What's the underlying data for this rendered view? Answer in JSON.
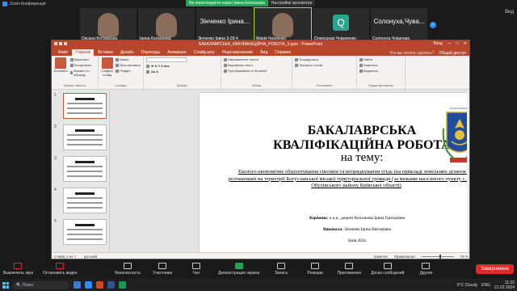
{
  "zoom": {
    "window_title": "Zoom Конференція",
    "banner_viewing": "Ви переглядаєте екран Ірина Колханова",
    "banner_options": "Настройки просмотра",
    "view_label": "Вид",
    "participants": [
      {
        "name": "Оксана Кустовська",
        "type": "video"
      },
      {
        "name": "Ірина Колханова",
        "type": "video"
      },
      {
        "name": "Зінченко Ірина 3-28-4",
        "type": "text",
        "display": "Зінченко Ірина..."
      },
      {
        "name": "Марія Черненко",
        "type": "video",
        "speaking": true
      },
      {
        "name": "Олександр Чумаченко",
        "type": "avatar",
        "avatar": "Q"
      },
      {
        "name": "Солонуха Чуванова",
        "type": "text",
        "display": "Солонуха,Чува..."
      }
    ],
    "controls_left": [
      "Выключить звук",
      "Остановить видео"
    ],
    "controls_mid": [
      {
        "label": "Безопасность"
      },
      {
        "label": "Участники",
        "count": "10"
      },
      {
        "label": "Чат"
      },
      {
        "label": "Демонстрация экрана",
        "share": true
      },
      {
        "label": "Запись"
      },
      {
        "label": "Реакции"
      },
      {
        "label": "Приложения"
      },
      {
        "label": "Доски сообщений"
      },
      {
        "label": "Другие"
      }
    ],
    "end_label": "Завершение"
  },
  "ppt": {
    "title": "БАКАЛАВРСЬКА_КВАЛІФІКАЦІЙНА_РОБОТА_3.pptx - PowerPoint",
    "tabs": [
      "Файл",
      "Главная",
      "Вставка",
      "Дизайн",
      "Переходы",
      "Анимация",
      "Слайд-шоу",
      "Рецензирование",
      "Вид",
      "Справка"
    ],
    "active_tab": 1,
    "search_hint": "Что вы хотите сделать?",
    "share_label": "Общий доступ",
    "login_label": "Вход",
    "ribbon_groups": [
      {
        "label": "Буфер обмена",
        "big": "Вставить",
        "items": [
          "Вырезать",
          "Копировать",
          "Формат по образцу"
        ]
      },
      {
        "label": "Слайды",
        "big": "Создать слайд",
        "items": [
          "Макет",
          "Восстановить",
          "Раздел"
        ]
      },
      {
        "label": "Шрифт",
        "items": [
          "Ж К Ч S abc",
          "Aa A"
        ]
      },
      {
        "label": "Абзац",
        "items": [
          "Направление текста",
          "Выровнять текст",
          "Преобразовать в SmartArt"
        ]
      },
      {
        "label": "Рисование",
        "items": [
          "Упорядочить",
          "Экспресс-стили"
        ]
      },
      {
        "label": "Редактирование",
        "items": [
          "Найти",
          "Заменить",
          "Выделить"
        ]
      }
    ],
    "status": {
      "slide": "Слайд 1 из 7",
      "lang": "русский",
      "notes": "Заметки",
      "comments": "Примечания",
      "zoom": "79 %"
    },
    "slide": {
      "line1": "БАКАЛАВРСЬКА",
      "line2": "КВАЛІФІКАЦІЙНА РОБОТА",
      "line3": "на тему:",
      "topic": "Еколого-економічне обґрунтування сівозмін та впорядкування угідь (на прикладі земельних ділянок що розташовані на території Богуславської міської територіальної громади (за межами населеного пункту с. Ісайки) Обухівського району Київської області)",
      "supervisor_label": "Керівник:",
      "supervisor": "к.е.н., доцент Колханова Ірина Григорівна",
      "executor_label": "Виконала:",
      "executor": "Зінченко Ірина Вікторівна",
      "city_year": "Київ 2024"
    },
    "thumbnails": [
      "1",
      "2",
      "3",
      "4",
      "5"
    ]
  },
  "taskbar": {
    "search": "Поиск",
    "weather": "5°C Cloudy",
    "lang": "ENG",
    "time": "11:32",
    "date": "21.02.2024"
  },
  "colors": {
    "ppt_accent": "#b7472a",
    "zoom_share": "#23a455",
    "zoom_end": "#e02828"
  }
}
